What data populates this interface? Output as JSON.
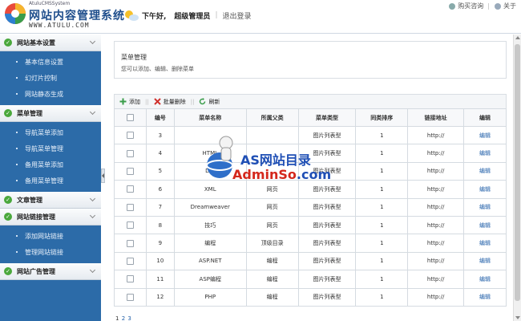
{
  "header": {
    "logo_cms": "AtuluCMSSystem",
    "logo_title": "网站内容管理系统",
    "logo_url": "WWW.ATULU.COM",
    "greeting": "下午好,",
    "user": "超级管理员",
    "logout": "退出登录",
    "help": "购买咨询",
    "about": "关于"
  },
  "sidebar": {
    "groups": [
      {
        "title": "网站基本设置",
        "items": [
          "基本信息设置",
          "幻灯片控制",
          "网站静态生成"
        ]
      },
      {
        "title": "菜单管理",
        "items": [
          "导航菜单添加",
          "导航菜单管理",
          "备用菜单添加",
          "备用菜单管理"
        ]
      },
      {
        "title": "文章管理",
        "items": []
      },
      {
        "title": "网站链接管理",
        "items": [
          "添加网站链接",
          "管理网站链接"
        ]
      },
      {
        "title": "网站广告管理",
        "items": []
      }
    ]
  },
  "panel": {
    "title": "菜单管理",
    "desc": "您可以添加、编辑、删除菜单"
  },
  "toolbar": {
    "add": "添加",
    "batch_delete": "批量删除",
    "refresh": "刷新"
  },
  "table": {
    "headers": [
      "",
      "编号",
      "菜单名称",
      "所属父类",
      "菜单类型",
      "同类排序",
      "链接地址",
      "编辑"
    ],
    "rows": [
      {
        "id": "3",
        "name": "",
        "parent": "",
        "type": "图片列表型",
        "sort": "1",
        "url": "http://",
        "edit": "编辑"
      },
      {
        "id": "4",
        "name": "HTML",
        "parent": "",
        "type": "图片列表型",
        "sort": "1",
        "url": "http://",
        "edit": "编辑"
      },
      {
        "id": "5",
        "name": "DIV",
        "parent": "",
        "type": "图片列表型",
        "sort": "1",
        "url": "http://",
        "edit": "编辑"
      },
      {
        "id": "6",
        "name": "XML",
        "parent": "网页",
        "type": "图片列表型",
        "sort": "1",
        "url": "http://",
        "edit": "编辑"
      },
      {
        "id": "7",
        "name": "Dreamweaver",
        "parent": "网页",
        "type": "图片列表型",
        "sort": "1",
        "url": "http://",
        "edit": "编辑"
      },
      {
        "id": "8",
        "name": "技巧",
        "parent": "网页",
        "type": "图片列表型",
        "sort": "1",
        "url": "http://",
        "edit": "编辑"
      },
      {
        "id": "9",
        "name": "编程",
        "parent": "顶级目录",
        "type": "图片列表型",
        "sort": "1",
        "url": "http://",
        "edit": "编辑"
      },
      {
        "id": "10",
        "name": "ASP.NET",
        "parent": "编程",
        "type": "图片列表型",
        "sort": "1",
        "url": "http://",
        "edit": "编辑"
      },
      {
        "id": "11",
        "name": "ASP编程",
        "parent": "编程",
        "type": "图片列表型",
        "sort": "1",
        "url": "http://",
        "edit": "编辑"
      },
      {
        "id": "12",
        "name": "PHP",
        "parent": "编程",
        "type": "图片列表型",
        "sort": "1",
        "url": "http://",
        "edit": "编辑"
      }
    ]
  },
  "pager": {
    "pages": [
      "1",
      "2",
      "3"
    ],
    "current": "1"
  },
  "watermark": {
    "line1": "AS网站目录",
    "line2_a": "AdminSo",
    "line2_b": ".com"
  }
}
